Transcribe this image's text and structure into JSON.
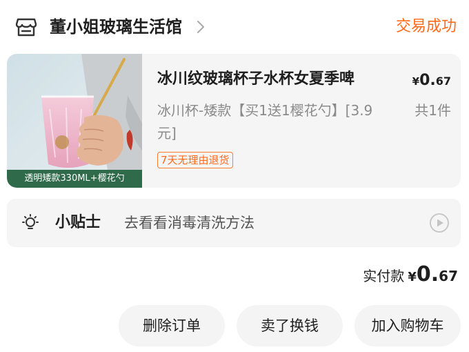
{
  "shop": {
    "name": "董小姐玻璃生活馆",
    "icon": "store-icon",
    "chevron_icon": "chevron-right-icon"
  },
  "order": {
    "status": "交易成功",
    "status_color": "#ff6a1a"
  },
  "product": {
    "title": "冰川纹玻璃杯子水杯女夏季啤",
    "price": {
      "currency": "¥",
      "integer": "0.",
      "decimal": "67"
    },
    "spec": "冰川杯-矮款【买1送1樱花勺】[3.9元]",
    "quantity": "共1件",
    "return_policy": "7天无理由退货",
    "image_caption": "透明矮款330ML+樱花勺"
  },
  "tips": {
    "title": "小贴士",
    "text": "去看看消毒清洗方法",
    "icon": "lightbulb-icon",
    "action_icon": "play-circle-icon"
  },
  "payment": {
    "label": "实付款",
    "currency": "¥",
    "integer": "0.",
    "decimal": "67"
  },
  "actions": {
    "delete": "删除订单",
    "resell": "卖了换钱",
    "add_to_cart": "加入购物车"
  },
  "colors": {
    "accent": "#ff6a1a",
    "card_bg": "#f5f5f5",
    "caption_bg": "#2f6b4a"
  }
}
